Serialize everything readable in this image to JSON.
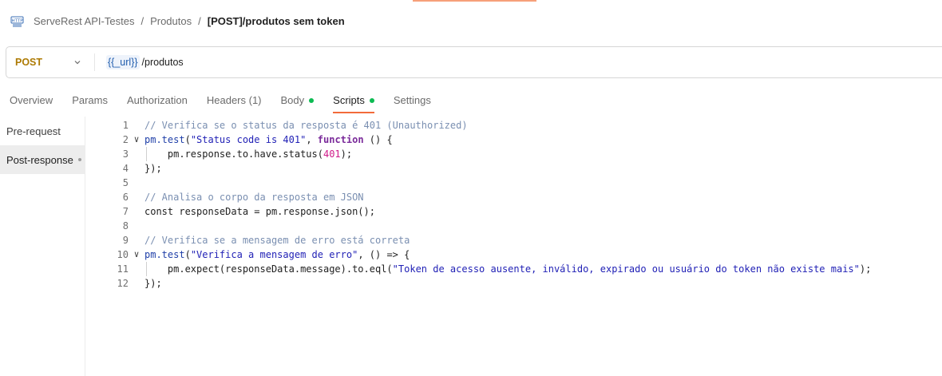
{
  "breadcrumb": {
    "collection": "ServeRest API-Testes",
    "folder": "Produtos",
    "request": "[POST]/produtos sem token",
    "separator": "/"
  },
  "request": {
    "method": "POST",
    "url_variable": "{{_url}}",
    "url_path": "/produtos"
  },
  "tabs": [
    {
      "label": "Overview"
    },
    {
      "label": "Params"
    },
    {
      "label": "Authorization"
    },
    {
      "label": "Headers (1)"
    },
    {
      "label": "Body",
      "dot": true
    },
    {
      "label": "Scripts",
      "dot": true,
      "active": true
    },
    {
      "label": "Settings"
    }
  ],
  "scripts_side": {
    "pre_request": "Pre-request",
    "post_response": "Post-response"
  },
  "colors": {
    "method_post": "#ad7a03",
    "active_tab_underline": "#f26b3a",
    "status_dot": "#0cbb52"
  },
  "code_lines": [
    {
      "n": "1",
      "fold": false,
      "tokens": [
        [
          "c-comment",
          "// Verifica se o status da resposta é 401 (Unauthorized)"
        ]
      ]
    },
    {
      "n": "2",
      "fold": true,
      "tokens": [
        [
          "c-fn",
          "pm.test"
        ],
        [
          "c-plain",
          "("
        ],
        [
          "c-str",
          "\"Status code is 401\""
        ],
        [
          "c-plain",
          ", "
        ],
        [
          "c-kw",
          "function"
        ],
        [
          "c-plain",
          " () {"
        ]
      ]
    },
    {
      "n": "3",
      "fold": false,
      "guide": true,
      "tokens": [
        [
          "c-plain",
          "    pm.response.to.have.status("
        ],
        [
          "c-num",
          "401"
        ],
        [
          "c-plain",
          ");"
        ]
      ]
    },
    {
      "n": "4",
      "fold": false,
      "tokens": [
        [
          "c-plain",
          "});"
        ]
      ]
    },
    {
      "n": "5",
      "fold": false,
      "tokens": []
    },
    {
      "n": "6",
      "fold": false,
      "tokens": [
        [
          "c-comment",
          "// Analisa o corpo da resposta em JSON"
        ]
      ]
    },
    {
      "n": "7",
      "fold": false,
      "tokens": [
        [
          "c-plain",
          "const responseData = pm.response.json();"
        ]
      ]
    },
    {
      "n": "8",
      "fold": false,
      "tokens": []
    },
    {
      "n": "9",
      "fold": false,
      "tokens": [
        [
          "c-comment",
          "// Verifica se a mensagem de erro está correta"
        ]
      ]
    },
    {
      "n": "10",
      "fold": true,
      "tokens": [
        [
          "c-fn",
          "pm.test"
        ],
        [
          "c-plain",
          "("
        ],
        [
          "c-str",
          "\"Verifica a mensagem de erro\""
        ],
        [
          "c-plain",
          ", () => {"
        ]
      ]
    },
    {
      "n": "11",
      "fold": false,
      "guide": true,
      "tokens": [
        [
          "c-plain",
          "    pm.expect(responseData.message).to.eql("
        ],
        [
          "c-str",
          "\"Token de acesso ausente, inválido, expirado ou usuário do token não existe mais\""
        ],
        [
          "c-plain",
          ");"
        ]
      ]
    },
    {
      "n": "12",
      "fold": false,
      "tokens": [
        [
          "c-plain",
          "});"
        ]
      ]
    }
  ]
}
